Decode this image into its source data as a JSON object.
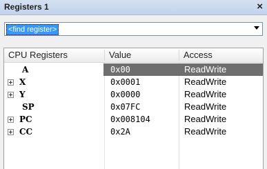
{
  "window": {
    "title": "Registers 1",
    "close_glyph": "×"
  },
  "search": {
    "value": "<find register>"
  },
  "columns": [
    "CPU Registers",
    "Value",
    "Access"
  ],
  "rows": [
    {
      "name": "A",
      "value": "0x00",
      "access": "ReadWrite",
      "expandable": false,
      "selected": true
    },
    {
      "name": "X",
      "value": "0x0001",
      "access": "ReadWrite",
      "expandable": true,
      "selected": false
    },
    {
      "name": "Y",
      "value": "0x0000",
      "access": "ReadWrite",
      "expandable": true,
      "selected": false
    },
    {
      "name": "SP",
      "value": "0x07FC",
      "access": "ReadWrite",
      "expandable": false,
      "selected": false
    },
    {
      "name": "PC",
      "value": "0x008104",
      "access": "ReadWrite",
      "expandable": true,
      "selected": false
    },
    {
      "name": "CC",
      "value": "0x2A",
      "access": "ReadWrite",
      "expandable": true,
      "selected": false
    }
  ],
  "colors": {
    "selection": "#6e6e6e",
    "titlebar": "#c8d7ec",
    "search_highlight": "#3399ff"
  }
}
